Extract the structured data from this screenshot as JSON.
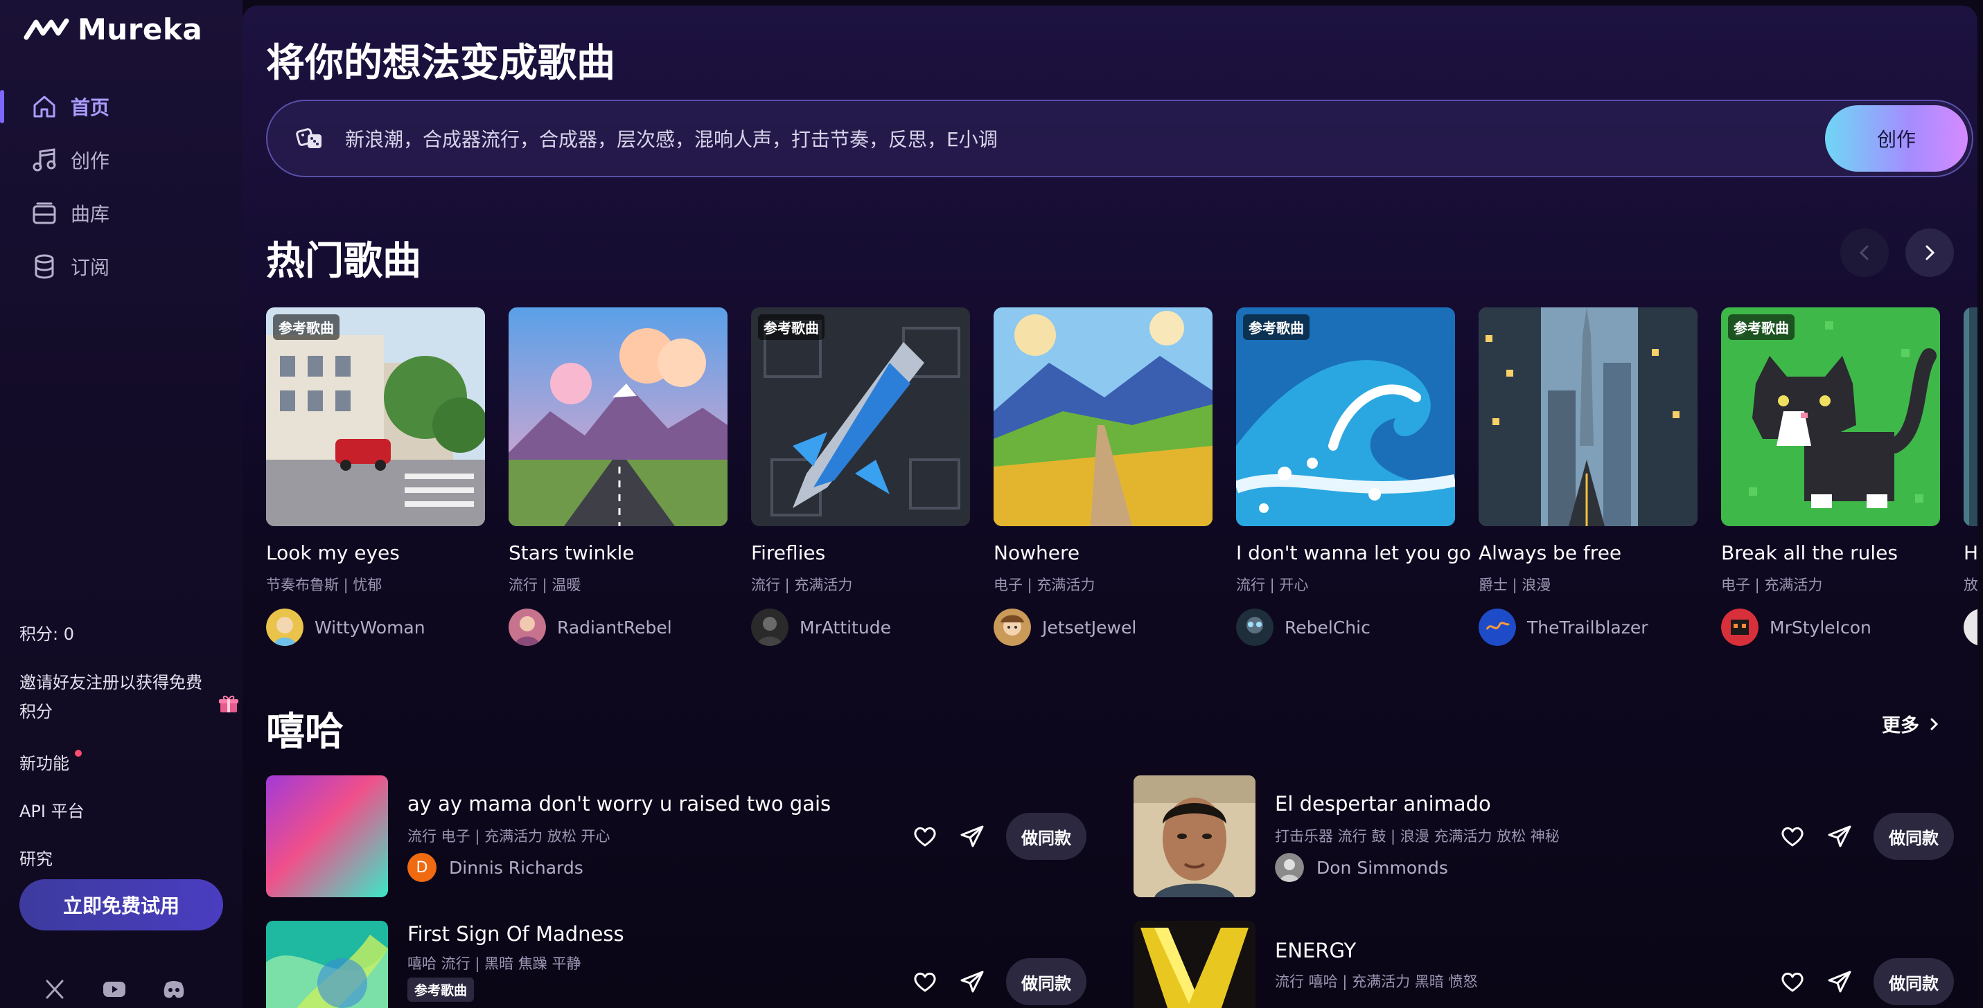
{
  "app": {
    "name": "Mureka"
  },
  "nav": [
    {
      "label": "首页",
      "icon": "home-icon",
      "active": true
    },
    {
      "label": "创作",
      "icon": "music-note-icon",
      "active": false
    },
    {
      "label": "曲库",
      "icon": "library-icon",
      "active": false
    },
    {
      "label": "订阅",
      "icon": "subscription-icon",
      "active": false
    }
  ],
  "sidebar": {
    "points": "积分: 0",
    "invite": "邀请好友注册以获得免费积分",
    "new_features": "新功能",
    "api": "API 平台",
    "research": "研究",
    "free_trial": "立即免费试用"
  },
  "hero": {
    "title": "将你的想法变成歌曲",
    "prompt": "新浪潮，合成器流行，合成器，层次感，混响人声，打击节奏，反思，E小调",
    "create_label": "创作"
  },
  "trending": {
    "title": "热门歌曲",
    "ref_tag": "参考歌曲",
    "cards": [
      {
        "title": "Look my eyes",
        "tags": "节奏布鲁斯 | 忧郁",
        "author": "WittyWoman",
        "ref": true
      },
      {
        "title": "Stars twinkle",
        "tags": "流行 | 温暖",
        "author": "RadiantRebel",
        "ref": false
      },
      {
        "title": "Fireflies",
        "tags": "流行 | 充满活力",
        "author": "MrAttitude",
        "ref": true
      },
      {
        "title": "Nowhere",
        "tags": "电子 | 充满活力",
        "author": "JetsetJewel",
        "ref": false
      },
      {
        "title": "I don't wanna let you go",
        "tags": "流行 | 开心",
        "author": "RebelChic",
        "ref": true
      },
      {
        "title": "Always be free",
        "tags": "爵士 | 浪漫",
        "author": "TheTrailblazer",
        "ref": false
      },
      {
        "title": "Break all the rules",
        "tags": "电子 | 充满活力",
        "author": "MrStyleIcon",
        "ref": true
      },
      {
        "title": "H",
        "tags": "放",
        "author": "",
        "ref": false
      }
    ]
  },
  "hiphop": {
    "title": "嘻哈",
    "more": "更多",
    "same_label": "做同款",
    "songs": [
      {
        "title": "ay ay mama don't worry u raised two gais",
        "tags": "流行 电子 | 充满活力 放松 开心",
        "author": "Dinnis Richards",
        "avatar_letter": "D"
      },
      {
        "title": "El despertar animado",
        "tags": "打击乐器 流行 鼓 | 浪漫 充满活力 放松 神秘",
        "author": "Don Simmonds"
      },
      {
        "title": "First Sign Of Madness",
        "tags": "嘻哈 流行 | 黑暗 焦躁 平静",
        "ref": "参考歌曲"
      },
      {
        "title": "ENERGY",
        "tags": "流行 嘻哈 | 充满活力 黑暗 愤怒"
      }
    ]
  },
  "colors": {
    "accent": "#7c68ff",
    "bg": "#0d0818"
  }
}
